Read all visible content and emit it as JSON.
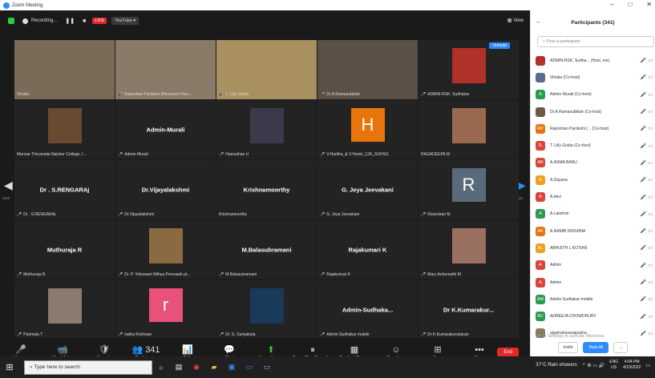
{
  "window": {
    "title": "Zoom Meeting",
    "controls": [
      "–",
      "□",
      "✕"
    ]
  },
  "topbar": {
    "recording": "Recording...",
    "live": "LIVE",
    "youtube": "YouTube ▾",
    "view": "View"
  },
  "colors": {
    "accent": "#2d8cff",
    "red": "#e02828",
    "green": "#2ecc40",
    "highlight": "#b8e34a"
  },
  "grid": {
    "unmute": "Unmute",
    "page_left": "1/14",
    "page_right": "1/14",
    "tiles": [
      {
        "kind": "camera",
        "label": "Vimala",
        "mic": false,
        "active": true,
        "bg": "#7a6a58"
      },
      {
        "kind": "camera",
        "label": "Rajmohan Pardeshi (Resource Pers...",
        "mic": true,
        "bg": "#8a7a68"
      },
      {
        "kind": "camera",
        "label": "T. Lilly Golda",
        "mic": true,
        "bg": "#a89060"
      },
      {
        "kind": "camera",
        "label": "Dr.A.Ramasubbiah",
        "mic": true,
        "bg": "#5a5045"
      },
      {
        "kind": "photo",
        "label": "ADMIN-RSK. Sudhakar",
        "mic": true,
        "photo": "#b0302a"
      },
      {
        "kind": "photo",
        "label": "Mannar Thirumalai Naicker College, I...",
        "mic": false,
        "photo": "#6a4a30"
      },
      {
        "kind": "name",
        "name": "Admin-Murali",
        "label": "Admin-Murali",
        "mic": true
      },
      {
        "kind": "photo",
        "label": "Harisuthan U",
        "mic": true,
        "photo": "#3a3a4a"
      },
      {
        "kind": "letter",
        "letter": "H",
        "letter_bg": "#e8740c",
        "label": "V.Haritha_& V.Harini_12A_SOHSS",
        "mic": true
      },
      {
        "kind": "photo",
        "label": "RAGADEEPA M",
        "mic": false,
        "photo": "#9a6a50"
      },
      {
        "kind": "name",
        "name": "Dr . S.RENGARAj",
        "label": "Dr . S.RENGARAj",
        "mic": true
      },
      {
        "kind": "name",
        "name": "Dr.Vijayalakshmi",
        "label": "Dr.Vijayalakshmi",
        "mic": true
      },
      {
        "kind": "name",
        "name": "Krishnamoorthy",
        "label": "Krishnamoorthy",
        "mic": false
      },
      {
        "kind": "name",
        "name": "G. Jeya Jeevakani",
        "label": "G. Jeya Jeevakani",
        "mic": true
      },
      {
        "kind": "letter",
        "letter": "R",
        "letter_bg": "#5a6a7a",
        "label": "Ravindran M",
        "mic": true
      },
      {
        "kind": "name",
        "name": "Muthuraja R",
        "label": "Muthuraja R",
        "mic": true
      },
      {
        "kind": "photo",
        "label": "Dr. P. Yoleswari Nithya Ponnaiah pl...",
        "mic": true,
        "photo": "#8a6a40"
      },
      {
        "kind": "name",
        "name": "M.Balasubramani",
        "label": "M.Balasubramani",
        "mic": true
      },
      {
        "kind": "name",
        "name": "Rajakumari K",
        "label": "Rajakumari K",
        "mic": true
      },
      {
        "kind": "photo",
        "label": "Mary Anbumathi M",
        "mic": true,
        "photo": "#9a7060"
      },
      {
        "kind": "photo",
        "label": "Parimala T",
        "mic": true,
        "photo": "#8a7a70"
      },
      {
        "kind": "letter",
        "letter": "r",
        "letter_bg": "#e8527a",
        "label": "radha Krishnan",
        "mic": true
      },
      {
        "kind": "photo",
        "label": "Dr. S. Suriyakala",
        "mic": true,
        "photo": "#1a3a5a"
      },
      {
        "kind": "name",
        "name": "Admin-Sudhaka...",
        "label": "Admin-Sudhakar mobile",
        "mic": true
      },
      {
        "kind": "name",
        "name": "Dr K.Kumarakur...",
        "label": "Dr K.Kumarakurubaran",
        "mic": true
      }
    ]
  },
  "toolbar": {
    "items": [
      {
        "icon": "🎤",
        "label": "Unmute",
        "name": "unmute"
      },
      {
        "icon": "📹",
        "label": "Start Video",
        "name": "start-video"
      },
      {
        "icon": "🛡",
        "label": "Security",
        "name": "security"
      },
      {
        "icon": "👥 341",
        "label": "Participants",
        "name": "participants"
      },
      {
        "icon": "📊",
        "label": "Polls",
        "name": "polls"
      },
      {
        "icon": "💬",
        "label": "Chat",
        "name": "chat"
      },
      {
        "icon": "⬆",
        "label": "Share Screen",
        "name": "share-screen",
        "green": true
      },
      {
        "icon": "⏸",
        "label": "Pause/Stop Recording",
        "name": "pause-recording"
      },
      {
        "icon": "▦",
        "label": "Breakout Rooms",
        "name": "breakout-rooms"
      },
      {
        "icon": "☺",
        "label": "Reactions",
        "name": "reactions"
      },
      {
        "icon": "⊞",
        "label": "Apps",
        "name": "apps"
      },
      {
        "icon": "•••",
        "label": "More",
        "name": "more"
      }
    ],
    "end": "End"
  },
  "participants": {
    "title": "Participants (341)",
    "search_placeholder": "Find a participant",
    "list": [
      {
        "initials": "",
        "name": "ADMIN-RSK. Sudha... (Host, me)",
        "color": "#b0302a"
      },
      {
        "initials": "",
        "name": "Vimala (Co-host)",
        "color": "#5a6a8a"
      },
      {
        "initials": "A",
        "name": "Admin-Murali (Co-host)",
        "color": "#2e9a4e"
      },
      {
        "initials": "",
        "name": "Dr.A.Ramasubbiah (Co-host)",
        "color": "#6a5a4a"
      },
      {
        "initials": "RP",
        "name": "Rajmohan Pardeshi (... (Co-host)",
        "color": "#e8740c"
      },
      {
        "initials": "TL",
        "name": "T. Lilly Golda (Co-host)",
        "color": "#d8453a"
      },
      {
        "initials": "AB",
        "name": "A.ASMA BANU",
        "color": "#d8453a"
      },
      {
        "initials": "A",
        "name": "A.Dayana",
        "color": "#f0a020"
      },
      {
        "initials": "A",
        "name": "A.devi",
        "color": "#d8453a"
      },
      {
        "initials": "A",
        "name": "A.Lakshmi",
        "color": "#2e9a4e"
      },
      {
        "initials": "AK",
        "name": "A.NAMBI KRISHNA",
        "color": "#e8740c"
      },
      {
        "initials": "AL",
        "name": "ABHIJITH L KOTIAN",
        "color": "#f0a020"
      },
      {
        "initials": "A",
        "name": "Admin",
        "color": "#d8453a"
      },
      {
        "initials": "A",
        "name": "Admin",
        "color": "#d8453a"
      },
      {
        "initials": "AM",
        "name": "Admin-Sudhakar mobile",
        "color": "#2e9a4e"
      },
      {
        "initials": "AC",
        "name": "ADREEJA CHOWDHURY",
        "color": "#2e9a4e"
      },
      {
        "initials": "",
        "name": "aijashahsaaraipasha",
        "color": "#8a7a60"
      }
    ],
    "invite": "Invite",
    "mute_all": "Mute All",
    "more": "...",
    "win_activate": "Go to Settings to activate Windows."
  },
  "taskbar": {
    "search_placeholder": "Type here to search",
    "weather": "37°C Rain showers",
    "lang": "ENG",
    "region": "US",
    "time": "4:04 PM",
    "date": "4/19/2022"
  }
}
